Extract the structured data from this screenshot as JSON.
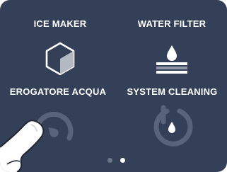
{
  "tiles": [
    {
      "label": "ICE MAKER",
      "icon": "ice-cube-icon"
    },
    {
      "label": "WATER FILTER",
      "icon": "water-filter-icon"
    },
    {
      "label": "EROGATORE ACQUA",
      "icon": "water-dispenser-gauge-icon"
    },
    {
      "label": "SYSTEM CLEANING",
      "icon": "system-cleaning-icon"
    }
  ],
  "pagination": {
    "pages": 2,
    "current_page": 2
  },
  "colors": {
    "background": "#344058",
    "label": "#ffffff",
    "icon_active": "#ffffff",
    "icon_dim": "#59647a",
    "dot_inactive": "#6b768b",
    "dot_active": "#ffffff"
  }
}
